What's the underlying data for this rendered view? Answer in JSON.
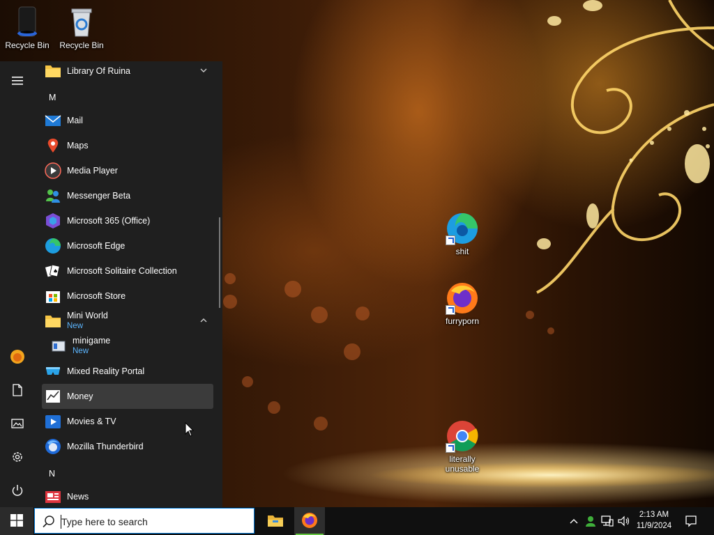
{
  "desktop": {
    "icons": [
      {
        "label": "Recycle Bin",
        "icon": "speaker-bin-icon"
      },
      {
        "label": "Recycle Bin",
        "icon": "recycle-bin-icon"
      },
      {
        "label": "shit",
        "icon": "edge-icon"
      },
      {
        "label": "furryporn",
        "icon": "firefox-icon"
      },
      {
        "label": "literally unusable",
        "icon": "chrome-icon"
      }
    ]
  },
  "start_menu": {
    "rail": [
      {
        "icon": "hamburger-menu-icon"
      },
      {
        "icon": "user-avatar-icon"
      },
      {
        "icon": "documents-icon"
      },
      {
        "icon": "pictures-icon"
      },
      {
        "icon": "settings-gear-icon"
      },
      {
        "icon": "power-icon"
      }
    ],
    "items": [
      {
        "kind": "folder",
        "label": "Library Of Ruina",
        "icon": "folder-icon",
        "expand": "collapsed"
      },
      {
        "kind": "letter",
        "label": "M"
      },
      {
        "kind": "app",
        "label": "Mail",
        "icon": "mail-icon"
      },
      {
        "kind": "app",
        "label": "Maps",
        "icon": "maps-icon"
      },
      {
        "kind": "app",
        "label": "Media Player",
        "icon": "media-player-icon"
      },
      {
        "kind": "app",
        "label": "Messenger Beta",
        "icon": "messenger-icon"
      },
      {
        "kind": "app",
        "label": "Microsoft 365 (Office)",
        "icon": "office-icon"
      },
      {
        "kind": "app",
        "label": "Microsoft Edge",
        "icon": "edge-icon"
      },
      {
        "kind": "app",
        "label": "Microsoft Solitaire Collection",
        "icon": "solitaire-icon"
      },
      {
        "kind": "app",
        "label": "Microsoft Store",
        "icon": "store-icon"
      },
      {
        "kind": "folder",
        "label": "Mini World",
        "badge": "New",
        "icon": "folder-icon",
        "expand": "expanded"
      },
      {
        "kind": "app",
        "label": "minigame",
        "badge": "New",
        "icon": "minigame-icon"
      },
      {
        "kind": "app",
        "label": "Mixed Reality Portal",
        "icon": "mixed-reality-icon"
      },
      {
        "kind": "app",
        "label": "Money",
        "icon": "money-icon",
        "selected": true
      },
      {
        "kind": "app",
        "label": "Movies & TV",
        "icon": "movies-tv-icon"
      },
      {
        "kind": "app",
        "label": "Mozilla Thunderbird",
        "icon": "thunderbird-icon"
      },
      {
        "kind": "letter",
        "label": "N"
      },
      {
        "kind": "app",
        "label": "News",
        "icon": "news-icon"
      }
    ]
  },
  "taskbar": {
    "start_icon": "windows-logo-icon",
    "search_placeholder": "Type here to search",
    "pinned": [
      {
        "name": "File Explorer",
        "icon": "file-explorer-icon"
      },
      {
        "name": "Firefox",
        "icon": "firefox-icon",
        "active": true
      }
    ],
    "tray": [
      "chevron-up-icon",
      "user-status-icon",
      "network-icon",
      "volume-icon"
    ],
    "clock": {
      "time": "2:13 AM",
      "date": "11/9/2024"
    },
    "notification_icon": "action-center-icon"
  },
  "colors": {
    "accent": "#0078d7",
    "new_badge": "#5cb6ff",
    "active_indicator": "#63c53f"
  }
}
